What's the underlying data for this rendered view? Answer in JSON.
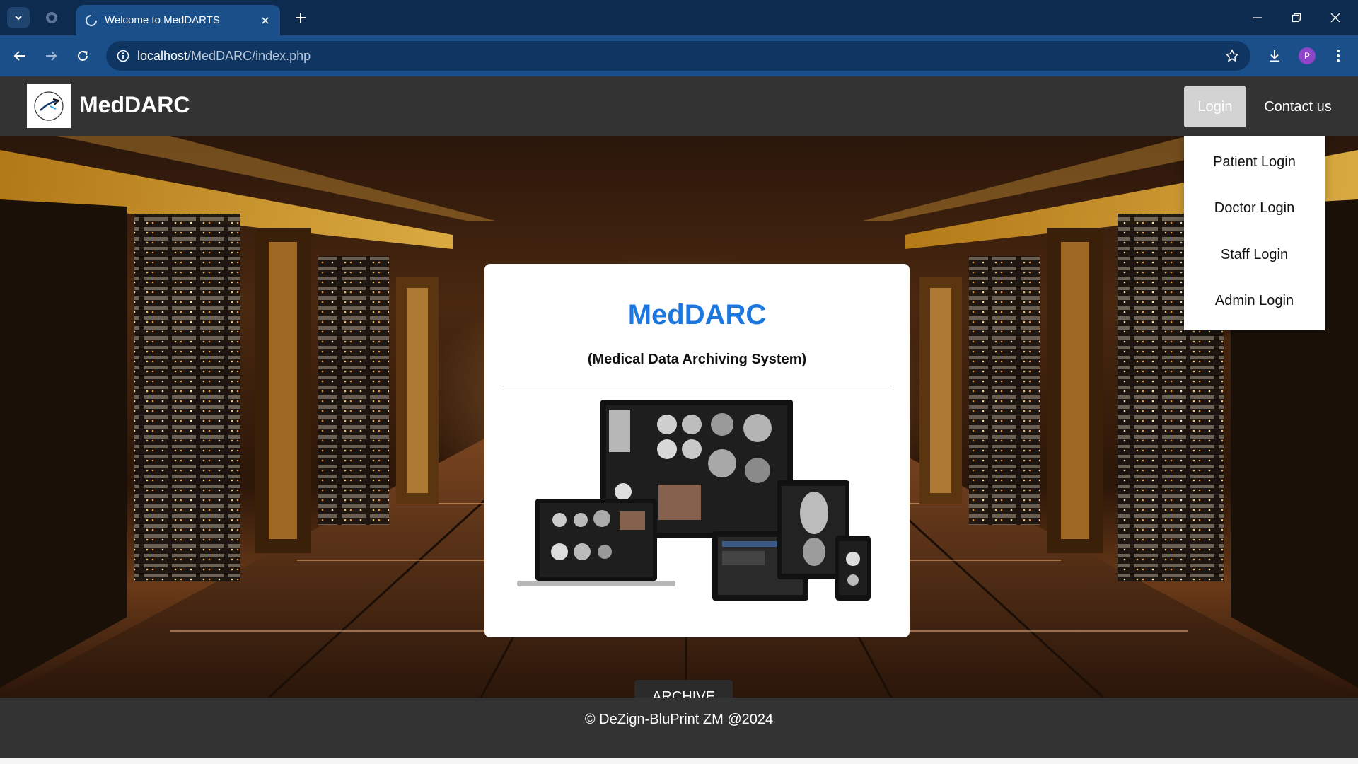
{
  "browser": {
    "tab_title": "Welcome to MedDARTS",
    "url_host": "localhost",
    "url_path": "/MedDARC/index.php",
    "profile_initial": "P",
    "icons": [
      "tab-list-icon",
      "tab-group-icon",
      "loading-icon",
      "close-icon",
      "plus-icon",
      "minimize-icon",
      "restore-icon",
      "window-close-icon",
      "back-arrow-icon",
      "forward-arrow-icon",
      "reload-icon",
      "info-icon",
      "star-icon",
      "download-icon",
      "kebab-menu-icon"
    ],
    "colors": {
      "tabbar": "#0d2b4e",
      "toolbar": "#1b4f8a"
    }
  },
  "site": {
    "brand": "MedDARC",
    "nav": {
      "login": "Login",
      "contact": "Contact us"
    },
    "dropdown": [
      "Patient Login",
      "Doctor Login",
      "Staff Login",
      "Admin Login"
    ],
    "card": {
      "title": "MedDARC",
      "subtitle": "(Medical Data Archiving System)"
    },
    "archive_button": "ARCHIVE",
    "footer": "© DeZign-BluPrint ZM @2024",
    "colors": {
      "nav": "#333333",
      "accent": "#1a78e0",
      "button": "#2b2b2b"
    }
  }
}
